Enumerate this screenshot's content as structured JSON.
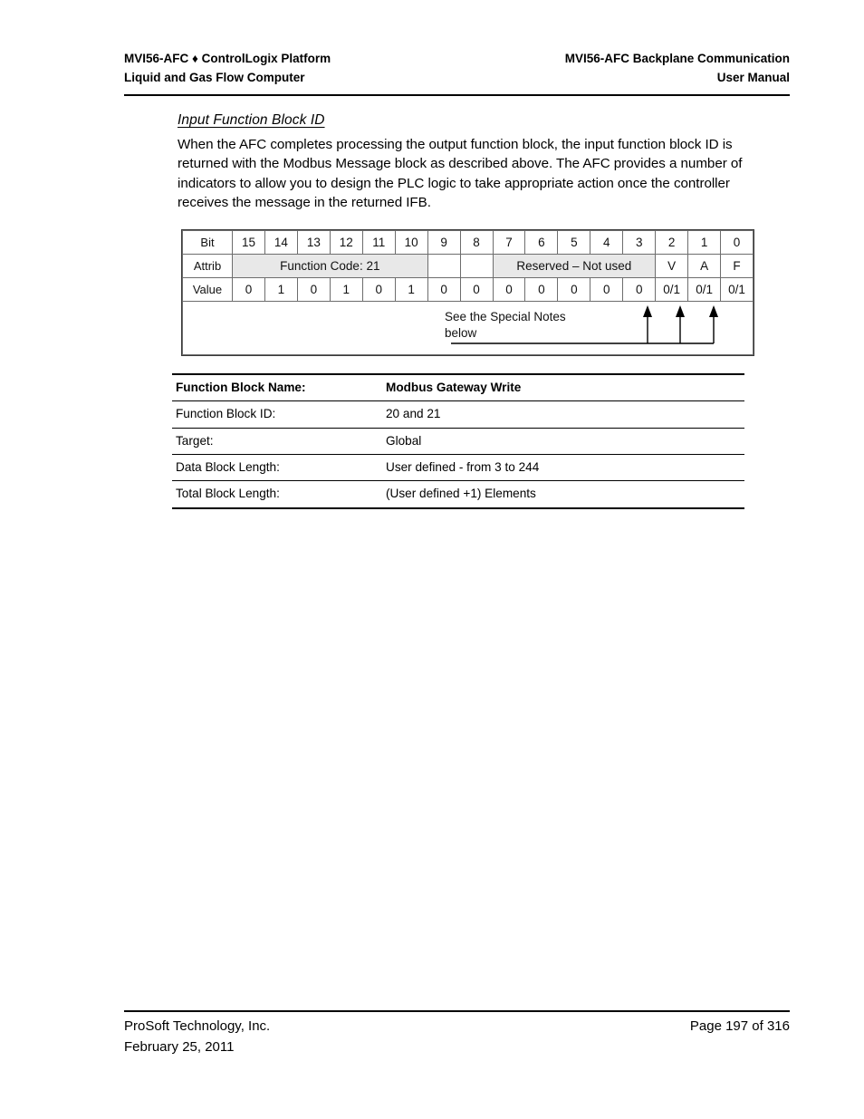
{
  "header": {
    "left_line1": "MVI56-AFC ♦ ControlLogix Platform",
    "left_line2": "Liquid and Gas Flow Computer",
    "right_line1": "MVI56-AFC Backplane Communication",
    "right_line2": "User Manual"
  },
  "section": {
    "heading": "Input Function Block ID",
    "paragraph": "When the AFC completes processing the output function block, the input function block ID is returned with the Modbus Message block as described above. The AFC provides a number of indicators to allow you to design the PLC logic to take appropriate action once the controller receives the message in the returned IFB."
  },
  "bit_table": {
    "row_labels": {
      "bit": "Bit",
      "attrib": "Attrib",
      "value": "Value"
    },
    "bits": [
      "15",
      "14",
      "13",
      "12",
      "11",
      "10",
      "9",
      "8",
      "7",
      "6",
      "5",
      "4",
      "3",
      "2",
      "1",
      "0"
    ],
    "attributes": [
      {
        "label": "Function Code: 21",
        "span": 6,
        "shaded": true
      },
      {
        "label": "",
        "span": 1,
        "shaded": false
      },
      {
        "label": "",
        "span": 1,
        "shaded": false
      },
      {
        "label": "Reserved – Not used",
        "span": 5,
        "shaded": true
      },
      {
        "label": "V",
        "span": 1,
        "shaded": false
      },
      {
        "label": "A",
        "span": 1,
        "shaded": false
      },
      {
        "label": "F",
        "span": 1,
        "shaded": false
      }
    ],
    "values": [
      "0",
      "1",
      "0",
      "1",
      "0",
      "1",
      "0",
      "0",
      "0",
      "0",
      "0",
      "0",
      "0",
      "0/1",
      "0/1",
      "0/1"
    ],
    "note_line1": "See the Special Notes",
    "note_line2": "below"
  },
  "info_table": {
    "rows": [
      {
        "label": "Function Block Name:",
        "value": "Modbus Gateway Write"
      },
      {
        "label": "Function Block ID:",
        "value": "20 and 21"
      },
      {
        "label": "Target:",
        "value": "Global"
      },
      {
        "label": "Data Block Length:",
        "value": "User defined - from 3 to 244"
      },
      {
        "label": "Total Block Length:",
        "value": "(User defined +1) Elements"
      }
    ]
  },
  "footer": {
    "left_line1": "ProSoft Technology, Inc.",
    "left_line2": "February 25, 2011",
    "right_line1": "Page 197 of 316"
  }
}
